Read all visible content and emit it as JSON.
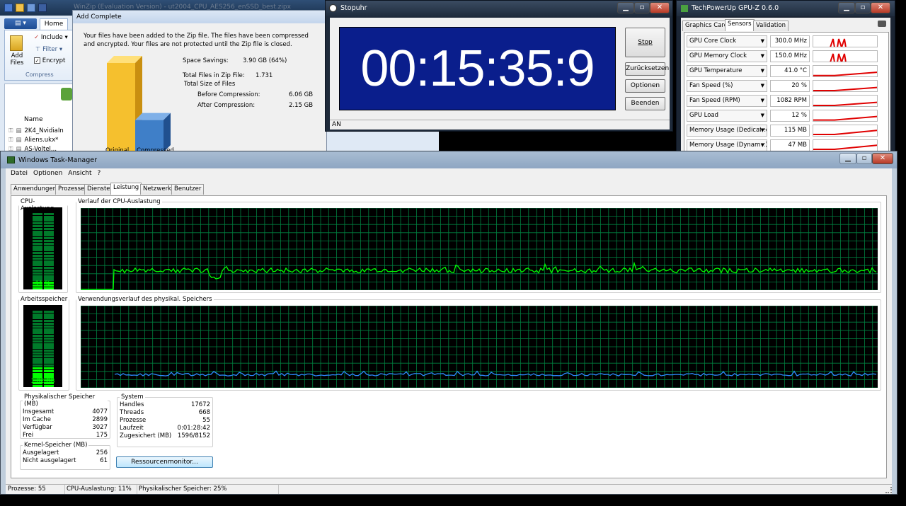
{
  "winzip": {
    "title": "WinZip (Evaluation Version) - ut2004_CPU_AES256_enSSD_best.zipx",
    "ribbon_tab_home": "Home",
    "add_files": "Add\nFiles",
    "include": "Include",
    "filter": "Filter",
    "encrypt": "Encrypt",
    "compress_group": "Compress",
    "list_header_name": "Name",
    "files": [
      "2K4_NvidiaIn",
      "Aliens.ukx*",
      "AS-Voltel..."
    ]
  },
  "add_complete": {
    "title": "Add Complete",
    "message": "Your files have been added to the Zip file. The files have been compressed and encrypted. Your files are not protected until the Zip file is closed.",
    "space_savings_label": "Space Savings:",
    "space_savings_value": "3.90 GB (64%)",
    "total_files_label": "Total Files in Zip File:",
    "total_files_value": "1.731",
    "total_size_label": "Total Size of Files",
    "before_label": "Before Compression:",
    "before_value": "6.06 GB",
    "after_label": "After Compression:",
    "after_value": "2.15 GB",
    "bar_original": "Original",
    "bar_compressed": "Compressed",
    "bar_ratio_compressed": 0.36
  },
  "stopuhr": {
    "title": "Stopuhr",
    "time": "00:15:35:9",
    "stop": "Stop",
    "reset": "Zurücksetzen",
    "options": "Optionen",
    "quit": "Beenden",
    "status": "AN"
  },
  "gpuz": {
    "title": "TechPowerUp GPU-Z 0.6.0",
    "tabs": [
      "Graphics Card",
      "Sensors",
      "Validation"
    ],
    "sensors": [
      {
        "label": "GPU Core Clock",
        "value": "300.0 MHz"
      },
      {
        "label": "GPU Memory Clock",
        "value": "150.0 MHz"
      },
      {
        "label": "GPU Temperature",
        "value": "41.0 °C"
      },
      {
        "label": "Fan Speed (%)",
        "value": "20 %"
      },
      {
        "label": "Fan Speed (RPM)",
        "value": "1082 RPM"
      },
      {
        "label": "GPU Load",
        "value": "12 %"
      },
      {
        "label": "Memory Usage (Dedicated)",
        "value": "115 MB"
      },
      {
        "label": "Memory Usage (Dynamic)",
        "value": "47 MB"
      }
    ]
  },
  "taskmgr": {
    "title": "Windows Task-Manager",
    "menu": [
      "Datei",
      "Optionen",
      "Ansicht",
      "?"
    ],
    "tabs": [
      "Anwendungen",
      "Prozesse",
      "Dienste",
      "Leistung",
      "Netzwerk",
      "Benutzer"
    ],
    "cpu_usage_label": "CPU-Auslastung",
    "cpu_usage_value": "11 %",
    "cpu_history_label": "Verlauf der CPU-Auslastung",
    "mem_label": "Arbeitsspeicher",
    "mem_value": "1,02 GB",
    "mem_history_label": "Verwendungsverlauf des physikal. Speichers",
    "phys_mem": {
      "title": "Physikalischer Speicher (MB)",
      "rows": [
        {
          "label": "Insgesamt",
          "value": "4077"
        },
        {
          "label": "Im Cache",
          "value": "2899"
        },
        {
          "label": "Verfügbar",
          "value": "3027"
        },
        {
          "label": "Frei",
          "value": "175"
        }
      ]
    },
    "kernel_mem": {
      "title": "Kernel-Speicher (MB)",
      "rows": [
        {
          "label": "Ausgelagert",
          "value": "256"
        },
        {
          "label": "Nicht ausgelagert",
          "value": "61"
        }
      ]
    },
    "system": {
      "title": "System",
      "rows": [
        {
          "label": "Handles",
          "value": "17672"
        },
        {
          "label": "Threads",
          "value": "668"
        },
        {
          "label": "Prozesse",
          "value": "55"
        },
        {
          "label": "Laufzeit",
          "value": "0:01:28:42"
        },
        {
          "label": "Zugesichert (MB)",
          "value": "1596/8152"
        }
      ]
    },
    "resource_monitor": "Ressourcenmonitor...",
    "status": {
      "processes": "Prozesse: 55",
      "cpu": "CPU-Auslastung: 11%",
      "memory": "Physikalischer Speicher: 25%"
    }
  },
  "colors": {
    "graph_grid": "#008040",
    "cpu_line": "#00ff00",
    "mem_line": "#2d8cff",
    "stopuhr_bg": "#0a1e8c",
    "gpuz_graph": "#e00000",
    "bar_original": "#f5c02e",
    "bar_compressed": "#3f7fc8"
  }
}
